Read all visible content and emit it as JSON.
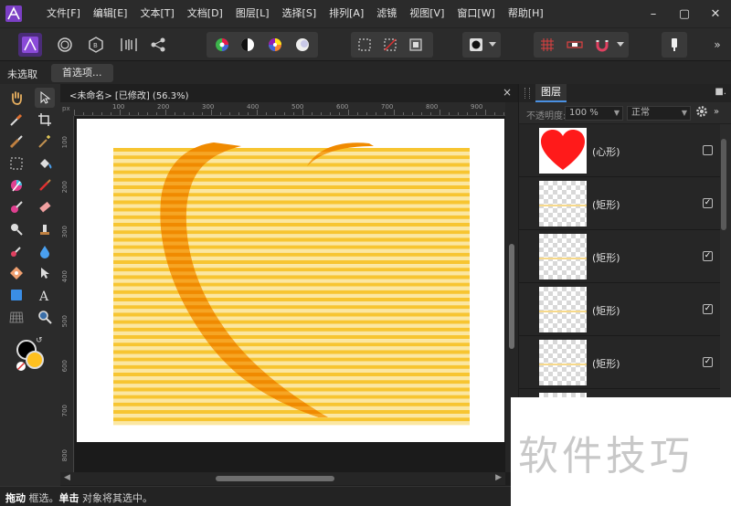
{
  "menubar": {
    "items": [
      "文件[F]",
      "编辑[E]",
      "文本[T]",
      "文档[D]",
      "图层[L]",
      "选择[S]",
      "排列[A]",
      "滤镜",
      "视图[V]",
      "窗口[W]",
      "帮助[H]"
    ]
  },
  "context": {
    "selection_label": "未选取",
    "prefs_label": "首选项..."
  },
  "document": {
    "tab_title": "<未命名> [已修改] (56.3%)",
    "close": "×"
  },
  "ruler": {
    "unit": "px",
    "top_ticks": [
      "100",
      "200",
      "300",
      "400",
      "500",
      "600",
      "700",
      "800",
      "900"
    ],
    "left_ticks": [
      "100",
      "200",
      "300",
      "400",
      "500",
      "600",
      "700",
      "800"
    ]
  },
  "layers_panel": {
    "tab_label": "图层",
    "opacity_label": "不透明度:",
    "opacity_value": "100 %",
    "blend_mode": "正常",
    "layers": [
      {
        "name": "(心形)",
        "checked": false
      },
      {
        "name": "(矩形)",
        "checked": true
      },
      {
        "name": "(矩形)",
        "checked": true
      },
      {
        "name": "(矩形)",
        "checked": true
      },
      {
        "name": "(矩形)",
        "checked": true
      },
      {
        "name": "",
        "checked": false
      }
    ]
  },
  "status": {
    "bold1": "拖动",
    "text1": " 框选。",
    "bold2": "单击",
    "text2": " 对象将其选中。"
  },
  "colors": {
    "accent": "#4a90e2",
    "stripe_yellow": "#f7c531",
    "stripe_light": "#fbe7a2",
    "heart_orange": "#f08a00",
    "heart_red": "#ff1a1a",
    "secondary_color": "#ffc01f"
  },
  "watermark": "软件技巧"
}
